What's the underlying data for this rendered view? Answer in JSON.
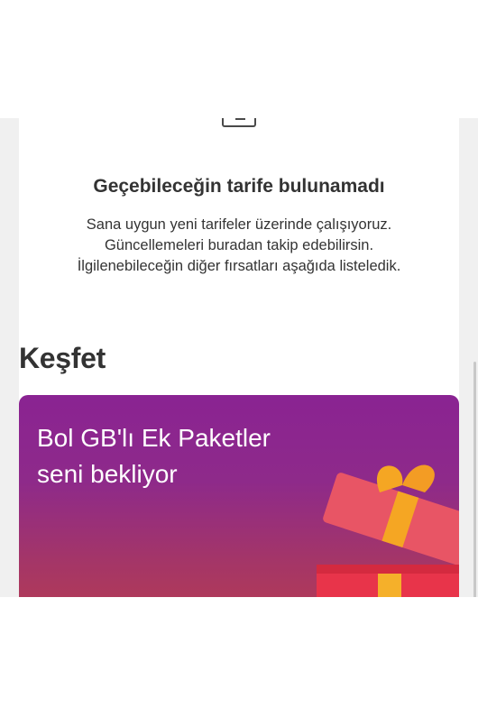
{
  "empty_state": {
    "icon": "empty-box-icon",
    "title": "Geçebileceğin tarife bulunamadı",
    "lines": [
      "Sana uygun yeni tarifeler üzerinde çalışıyoruz.",
      "Güncellemeleri buradan takip edebilirsin.",
      "İlgilenebileceğin diğer fırsatları aşağıda listeledik."
    ]
  },
  "discover": {
    "title": "Keşfet",
    "promo": {
      "lines": [
        "Bol GB'lı Ek Paketler",
        "seni bekliyor"
      ],
      "image": "gift-box-icon",
      "colors": {
        "gradient_top": "#8a2392",
        "gradient_bottom": "#b23b56",
        "ribbon": "#f5a623",
        "box": "#e8344a"
      }
    }
  }
}
